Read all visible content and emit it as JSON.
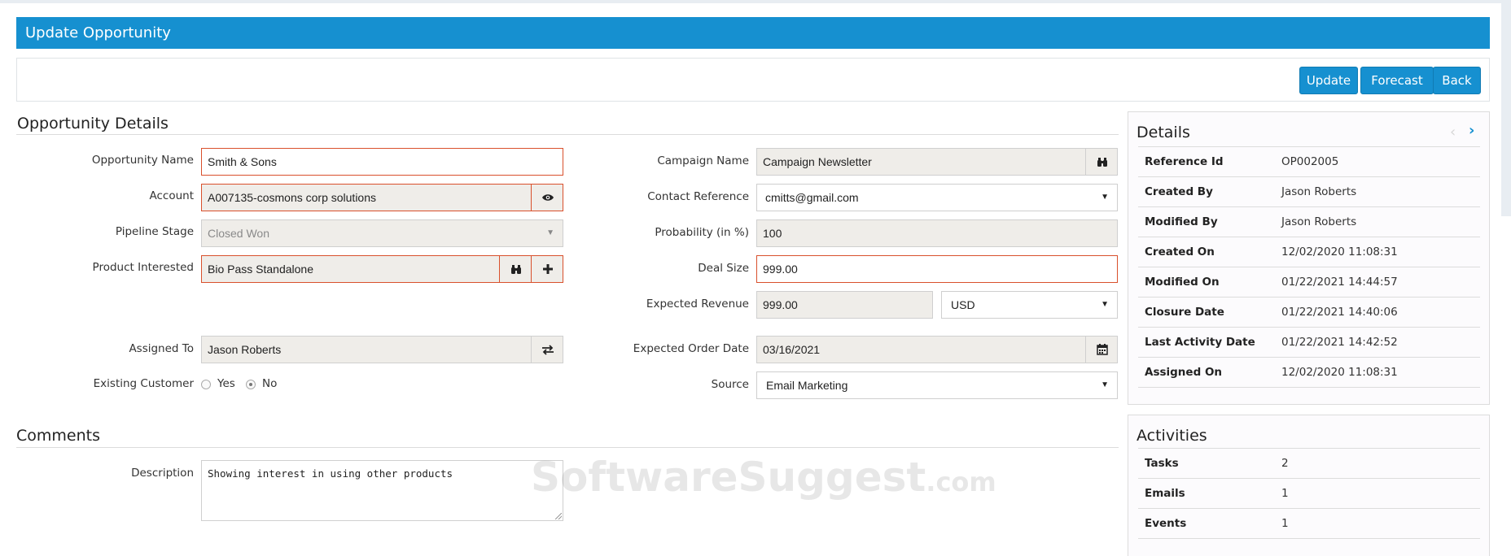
{
  "page": {
    "title": "Update Opportunity"
  },
  "toolbar": {
    "update": "Update",
    "forecast": "Forecast",
    "back": "Back"
  },
  "sections": {
    "details": "Opportunity Details",
    "comments": "Comments"
  },
  "left_form": {
    "opportunity_name": {
      "label": "Opportunity Name",
      "value": "Smith & Sons"
    },
    "account": {
      "label": "Account",
      "value": "A007135-cosmons corp solutions"
    },
    "pipeline_stage": {
      "label": "Pipeline Stage",
      "value": "Closed Won"
    },
    "product_interested": {
      "label": "Product Interested",
      "value": "Bio Pass Standalone"
    },
    "assigned_to": {
      "label": "Assigned To",
      "value": "Jason Roberts"
    },
    "existing_customer": {
      "label": "Existing Customer",
      "yes": "Yes",
      "no": "No",
      "selected": "No"
    }
  },
  "right_form": {
    "campaign_name": {
      "label": "Campaign Name",
      "value": "Campaign Newsletter"
    },
    "contact_reference": {
      "label": "Contact Reference",
      "value": "cmitts@gmail.com"
    },
    "probability": {
      "label": "Probability (in %)",
      "value": "100"
    },
    "deal_size": {
      "label": "Deal Size",
      "value": "999.00"
    },
    "expected_revenue": {
      "label": "Expected Revenue",
      "value": "999.00",
      "currency": "USD"
    },
    "expected_order_date": {
      "label": "Expected Order Date",
      "value": "03/16/2021"
    },
    "source": {
      "label": "Source",
      "value": "Email Marketing"
    }
  },
  "comments": {
    "label": "Description",
    "value": "Showing interest in using other products"
  },
  "details_panel": {
    "title": "Details",
    "rows": [
      {
        "key": "Reference Id",
        "value": "OP002005"
      },
      {
        "key": "Created By",
        "value": "Jason Roberts"
      },
      {
        "key": "Modified By",
        "value": "Jason Roberts"
      },
      {
        "key": "Created On",
        "value": "12/02/2020 11:08:31"
      },
      {
        "key": "Modified On",
        "value": "01/22/2021 14:44:57"
      },
      {
        "key": "Closure Date",
        "value": "01/22/2021 14:40:06"
      },
      {
        "key": "Last Activity Date",
        "value": "01/22/2021 14:42:52"
      },
      {
        "key": "Assigned On",
        "value": "12/02/2020 11:08:31"
      }
    ]
  },
  "activities_panel": {
    "title": "Activities",
    "rows": [
      {
        "key": "Tasks",
        "value": "2"
      },
      {
        "key": "Emails",
        "value": "1"
      },
      {
        "key": "Events",
        "value": "1"
      }
    ]
  },
  "watermark": {
    "main": "SoftwareSuggest",
    "suffix": ".com"
  },
  "icons": {
    "binoculars": "binoculars-icon",
    "eye": "eye-icon",
    "plus": "plus-icon",
    "swap": "swap-icon",
    "calendar": "calendar-icon",
    "prev": "chevron-left-icon",
    "next": "chevron-right-icon"
  },
  "colors": {
    "brand": "#1690d0",
    "required_border": "#d9502c"
  }
}
